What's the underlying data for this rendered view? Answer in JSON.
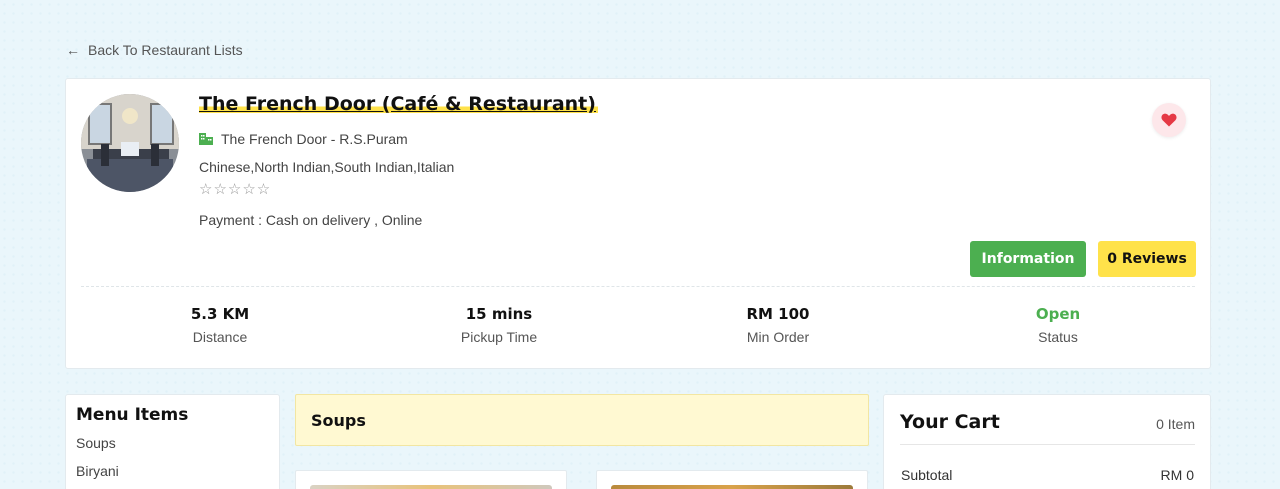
{
  "nav": {
    "back_label": "Back To Restaurant Lists"
  },
  "restaurant": {
    "name": "The French Door (Café & Restaurant)",
    "branch": "The French Door - R.S.Puram",
    "cuisines": "Chinese,North Indian,South Indian,Italian",
    "rating_stars": "☆☆☆☆☆",
    "rating": 0,
    "payment": "Payment : Cash on delivery , Online"
  },
  "actions": {
    "information_label": "Information",
    "reviews_label": "0 Reviews"
  },
  "stats": [
    {
      "value": "5.3 KM",
      "label": "Distance"
    },
    {
      "value": "15 mins",
      "label": "Pickup Time"
    },
    {
      "value": "RM 100",
      "label": "Min Order"
    },
    {
      "value": "Open",
      "label": "Status"
    }
  ],
  "menu": {
    "title": "Menu Items",
    "items": [
      "Soups",
      "Biryani"
    ]
  },
  "category": {
    "title": "Soups"
  },
  "cart": {
    "title": "Your Cart",
    "count": "0 Item",
    "subtotal_label": "Subtotal",
    "subtotal_value": "RM 0"
  },
  "colors": {
    "accent_green": "#4caf50",
    "accent_yellow": "#ffe24a",
    "heart": "#e53945"
  },
  "icons": [
    "arrow-left-icon",
    "building-icon",
    "heart-icon"
  ]
}
